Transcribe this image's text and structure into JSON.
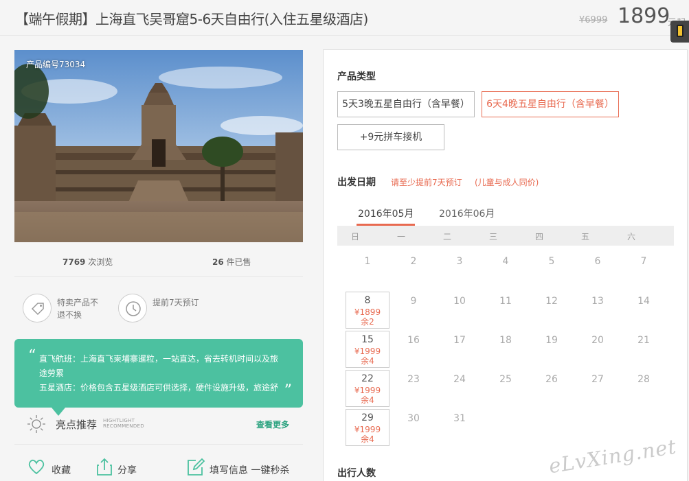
{
  "header": {
    "title": "【端午假期】上海直飞吴哥窟5-6天自由行(入住五星级酒店)",
    "old_price": "¥6999",
    "price": "1899",
    "price_unit": "元起"
  },
  "product": {
    "code": "产品编号73034",
    "views_count": "7769",
    "views_label": "次浏览",
    "sold_count": "26",
    "sold_label": "件已售"
  },
  "guarantees": [
    {
      "text": "特卖产品不退不换",
      "icon": "tag-icon"
    },
    {
      "text": "提前7天预订",
      "icon": "clock-icon"
    }
  ],
  "promo": {
    "line1": "直飞航班：上海直飞柬埔寨暹粒，一站直达，省去转机时间以及旅",
    "line2": "途劳累",
    "line3": "五星酒店：价格包含五星级酒店可供选择，硬件设施升级，旅途舒"
  },
  "highlight": {
    "title": "亮点推荐",
    "en_line1": "HIGHTLIGHT",
    "en_line2": "RECOMMENDED",
    "more": "查看更多"
  },
  "actions": {
    "favorite": "收藏",
    "share": "分享",
    "fill": "填写信息 一键秒杀"
  },
  "panel": {
    "product_type_title": "产品类型",
    "options": [
      {
        "label": "5天3晚五星自由行（含早餐）",
        "selected": false
      },
      {
        "label": "6天4晚五星自由行（含早餐）",
        "selected": true
      },
      {
        "label": "+9元拼车接机",
        "selected": false
      }
    ],
    "departure_title": "出发日期",
    "note1": "请至少提前7天预订",
    "note2": "(儿童与成人同价)",
    "months": [
      "2016年05月",
      "2016年06月"
    ],
    "weekdays": [
      "日",
      "一",
      "二",
      "三",
      "四",
      "五",
      "六"
    ],
    "calendar": [
      [
        "",
        "1",
        "2",
        "3",
        "4",
        "5",
        "6",
        "7"
      ],
      [
        "8",
        "9",
        "10",
        "11",
        "12",
        "13",
        "14"
      ],
      [
        "15",
        "16",
        "17",
        "18",
        "19",
        "20",
        "21"
      ],
      [
        "22",
        "23",
        "24",
        "25",
        "26",
        "27",
        "28"
      ],
      [
        "29",
        "30",
        "31"
      ]
    ],
    "available": {
      "8": {
        "price": "¥1899",
        "remain": "余2"
      },
      "15": {
        "price": "¥1999",
        "remain": "余4"
      },
      "22": {
        "price": "¥1999",
        "remain": "余4"
      },
      "29": {
        "price": "¥1999",
        "remain": "余4"
      }
    },
    "people_title": "出行人数"
  },
  "watermark": "eLvXing.net",
  "colors": {
    "accent": "#e86a50",
    "promo_bg": "#4cc1a0",
    "link": "#2aa27f"
  }
}
